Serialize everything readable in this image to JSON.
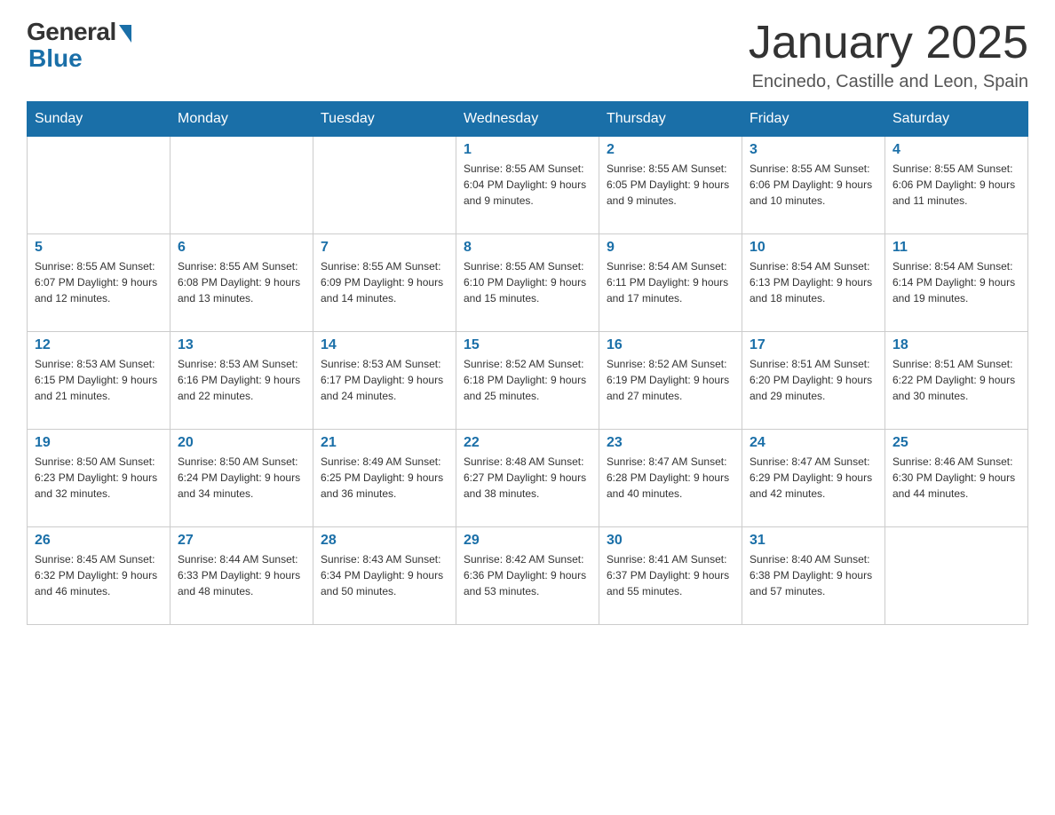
{
  "header": {
    "logo_general": "General",
    "logo_blue": "Blue",
    "month_title": "January 2025",
    "location": "Encinedo, Castille and Leon, Spain"
  },
  "days_of_week": [
    "Sunday",
    "Monday",
    "Tuesday",
    "Wednesday",
    "Thursday",
    "Friday",
    "Saturday"
  ],
  "weeks": [
    [
      {
        "day": "",
        "info": ""
      },
      {
        "day": "",
        "info": ""
      },
      {
        "day": "",
        "info": ""
      },
      {
        "day": "1",
        "info": "Sunrise: 8:55 AM\nSunset: 6:04 PM\nDaylight: 9 hours and 9 minutes."
      },
      {
        "day": "2",
        "info": "Sunrise: 8:55 AM\nSunset: 6:05 PM\nDaylight: 9 hours and 9 minutes."
      },
      {
        "day": "3",
        "info": "Sunrise: 8:55 AM\nSunset: 6:06 PM\nDaylight: 9 hours and 10 minutes."
      },
      {
        "day": "4",
        "info": "Sunrise: 8:55 AM\nSunset: 6:06 PM\nDaylight: 9 hours and 11 minutes."
      }
    ],
    [
      {
        "day": "5",
        "info": "Sunrise: 8:55 AM\nSunset: 6:07 PM\nDaylight: 9 hours and 12 minutes."
      },
      {
        "day": "6",
        "info": "Sunrise: 8:55 AM\nSunset: 6:08 PM\nDaylight: 9 hours and 13 minutes."
      },
      {
        "day": "7",
        "info": "Sunrise: 8:55 AM\nSunset: 6:09 PM\nDaylight: 9 hours and 14 minutes."
      },
      {
        "day": "8",
        "info": "Sunrise: 8:55 AM\nSunset: 6:10 PM\nDaylight: 9 hours and 15 minutes."
      },
      {
        "day": "9",
        "info": "Sunrise: 8:54 AM\nSunset: 6:11 PM\nDaylight: 9 hours and 17 minutes."
      },
      {
        "day": "10",
        "info": "Sunrise: 8:54 AM\nSunset: 6:13 PM\nDaylight: 9 hours and 18 minutes."
      },
      {
        "day": "11",
        "info": "Sunrise: 8:54 AM\nSunset: 6:14 PM\nDaylight: 9 hours and 19 minutes."
      }
    ],
    [
      {
        "day": "12",
        "info": "Sunrise: 8:53 AM\nSunset: 6:15 PM\nDaylight: 9 hours and 21 minutes."
      },
      {
        "day": "13",
        "info": "Sunrise: 8:53 AM\nSunset: 6:16 PM\nDaylight: 9 hours and 22 minutes."
      },
      {
        "day": "14",
        "info": "Sunrise: 8:53 AM\nSunset: 6:17 PM\nDaylight: 9 hours and 24 minutes."
      },
      {
        "day": "15",
        "info": "Sunrise: 8:52 AM\nSunset: 6:18 PM\nDaylight: 9 hours and 25 minutes."
      },
      {
        "day": "16",
        "info": "Sunrise: 8:52 AM\nSunset: 6:19 PM\nDaylight: 9 hours and 27 minutes."
      },
      {
        "day": "17",
        "info": "Sunrise: 8:51 AM\nSunset: 6:20 PM\nDaylight: 9 hours and 29 minutes."
      },
      {
        "day": "18",
        "info": "Sunrise: 8:51 AM\nSunset: 6:22 PM\nDaylight: 9 hours and 30 minutes."
      }
    ],
    [
      {
        "day": "19",
        "info": "Sunrise: 8:50 AM\nSunset: 6:23 PM\nDaylight: 9 hours and 32 minutes."
      },
      {
        "day": "20",
        "info": "Sunrise: 8:50 AM\nSunset: 6:24 PM\nDaylight: 9 hours and 34 minutes."
      },
      {
        "day": "21",
        "info": "Sunrise: 8:49 AM\nSunset: 6:25 PM\nDaylight: 9 hours and 36 minutes."
      },
      {
        "day": "22",
        "info": "Sunrise: 8:48 AM\nSunset: 6:27 PM\nDaylight: 9 hours and 38 minutes."
      },
      {
        "day": "23",
        "info": "Sunrise: 8:47 AM\nSunset: 6:28 PM\nDaylight: 9 hours and 40 minutes."
      },
      {
        "day": "24",
        "info": "Sunrise: 8:47 AM\nSunset: 6:29 PM\nDaylight: 9 hours and 42 minutes."
      },
      {
        "day": "25",
        "info": "Sunrise: 8:46 AM\nSunset: 6:30 PM\nDaylight: 9 hours and 44 minutes."
      }
    ],
    [
      {
        "day": "26",
        "info": "Sunrise: 8:45 AM\nSunset: 6:32 PM\nDaylight: 9 hours and 46 minutes."
      },
      {
        "day": "27",
        "info": "Sunrise: 8:44 AM\nSunset: 6:33 PM\nDaylight: 9 hours and 48 minutes."
      },
      {
        "day": "28",
        "info": "Sunrise: 8:43 AM\nSunset: 6:34 PM\nDaylight: 9 hours and 50 minutes."
      },
      {
        "day": "29",
        "info": "Sunrise: 8:42 AM\nSunset: 6:36 PM\nDaylight: 9 hours and 53 minutes."
      },
      {
        "day": "30",
        "info": "Sunrise: 8:41 AM\nSunset: 6:37 PM\nDaylight: 9 hours and 55 minutes."
      },
      {
        "day": "31",
        "info": "Sunrise: 8:40 AM\nSunset: 6:38 PM\nDaylight: 9 hours and 57 minutes."
      },
      {
        "day": "",
        "info": ""
      }
    ]
  ]
}
